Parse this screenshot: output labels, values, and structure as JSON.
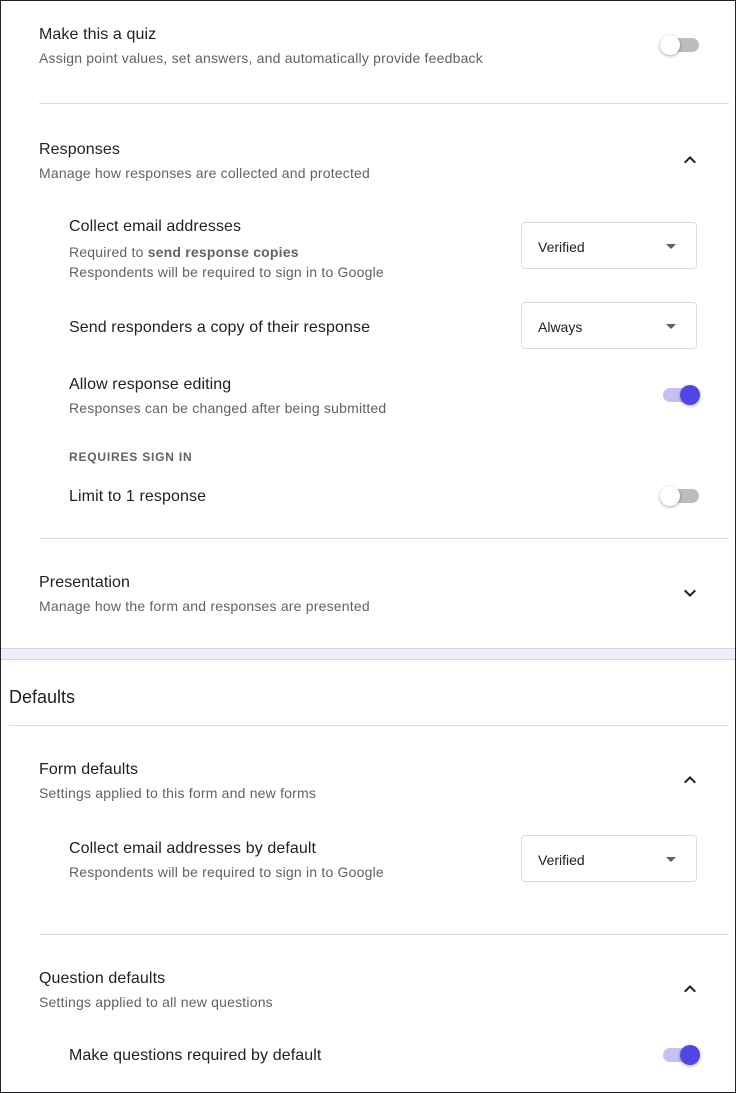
{
  "quiz": {
    "title": "Make this a quiz",
    "description": "Assign point values, set answers, and automatically provide feedback",
    "enabled": false
  },
  "responses": {
    "title": "Responses",
    "description": "Manage how responses are collected and protected",
    "expanded": true,
    "collect_email": {
      "title": "Collect email addresses",
      "required_prefix": "Required to",
      "required_bold": "send response copies",
      "description": "Respondents will be required to sign in to Google",
      "value": "Verified"
    },
    "send_copy": {
      "title": "Send responders a copy of their response",
      "value": "Always"
    },
    "allow_editing": {
      "title": "Allow response editing",
      "description": "Responses can be changed after being submitted",
      "enabled": true
    },
    "requires_sign_in_label": "REQUIRES SIGN IN",
    "limit_one": {
      "title": "Limit to 1 response",
      "enabled": false
    }
  },
  "presentation": {
    "title": "Presentation",
    "description": "Manage how the form and responses are presented",
    "expanded": false
  },
  "defaults": {
    "heading": "Defaults",
    "form_defaults": {
      "title": "Form defaults",
      "description": "Settings applied to this form and new forms",
      "expanded": true,
      "collect_email_default": {
        "title": "Collect email addresses by default",
        "description": "Respondents will be required to sign in to Google",
        "value": "Verified"
      }
    },
    "question_defaults": {
      "title": "Question defaults",
      "description": "Settings applied to all new questions",
      "expanded": true,
      "required_default": {
        "title": "Make questions required by default",
        "enabled": true
      }
    }
  },
  "colors": {
    "accent": "#4f46e5",
    "accent_track": "#c5c2f3",
    "toggle_off_track": "#bdbdbd",
    "divider": "#dadce0",
    "secondary_text": "#5f6368"
  },
  "icons": {
    "collapse": "chevron-up-icon",
    "expand": "chevron-down-icon",
    "dropdown": "dropdown-arrow-icon"
  }
}
